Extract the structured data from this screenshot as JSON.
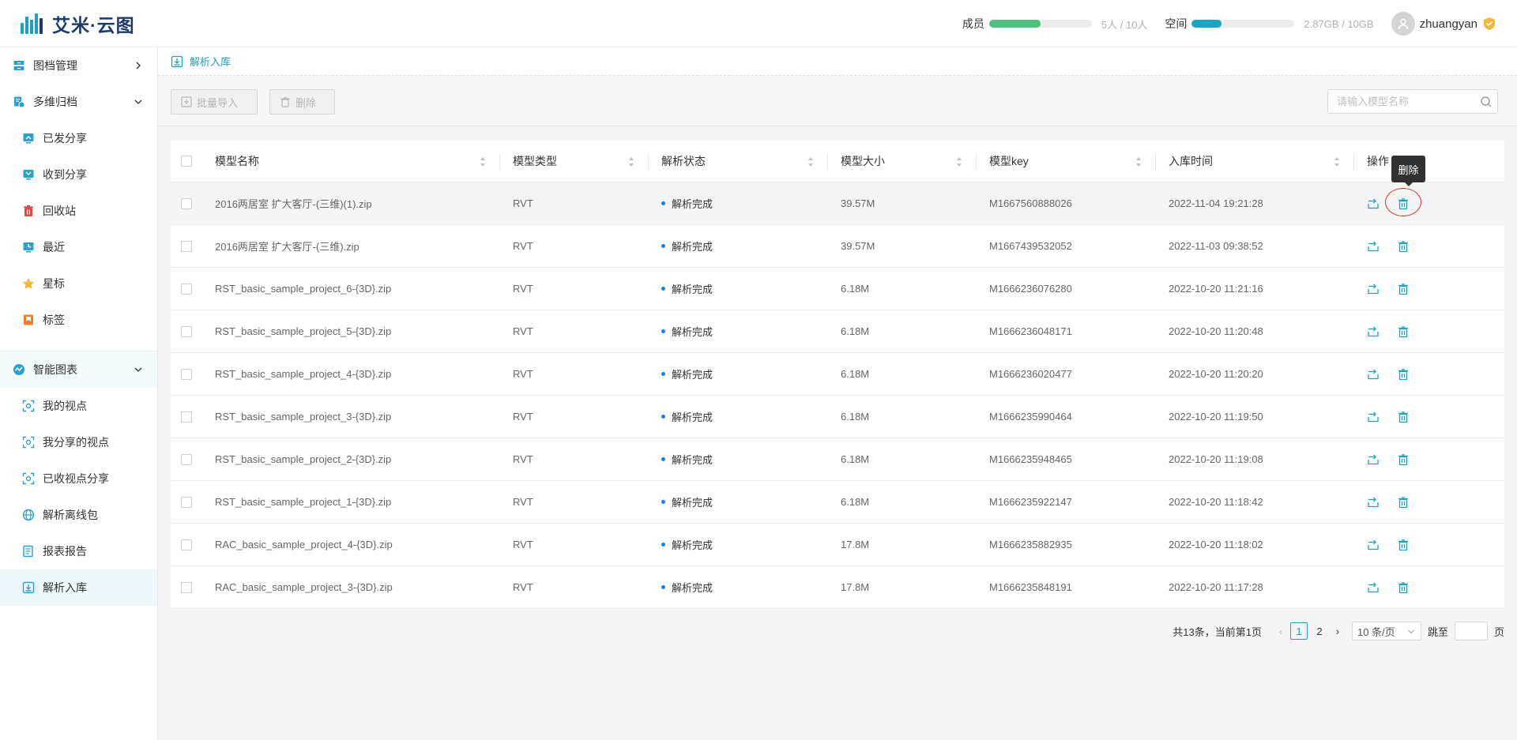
{
  "brand": {
    "name": "艾米·云图"
  },
  "header": {
    "members": {
      "label": "成员",
      "value": "5人 / 10人",
      "fraction": 0.5,
      "color": "#4cc080"
    },
    "space": {
      "label": "空间",
      "value": "2.87GB / 10GB",
      "fraction": 0.287,
      "color": "#1aa3c2"
    },
    "user": {
      "name": "zhuangyan",
      "avatar_icon": "user-avatar-icon",
      "badge_icon": "vip-shield-icon"
    }
  },
  "sidebar": {
    "groups": [
      {
        "label": "图档管理",
        "icon": "archive-icon",
        "expanded": false
      },
      {
        "label": "多维归档",
        "icon": "multi-archive-icon",
        "expanded": true,
        "items": [
          {
            "label": "已发分享",
            "icon": "share-sent-icon"
          },
          {
            "label": "收到分享",
            "icon": "share-received-icon"
          },
          {
            "label": "回收站",
            "icon": "trash-icon"
          },
          {
            "label": "最近",
            "icon": "recent-icon"
          },
          {
            "label": "星标",
            "icon": "star-icon"
          },
          {
            "label": "标签",
            "icon": "tag-icon"
          }
        ]
      },
      {
        "label": "智能图表",
        "icon": "smart-chart-icon",
        "expanded": true,
        "items": [
          {
            "label": "我的视点",
            "icon": "viewpoint-icon"
          },
          {
            "label": "我分享的视点",
            "icon": "viewpoint-shared-icon"
          },
          {
            "label": "已收视点分享",
            "icon": "viewpoint-received-icon"
          },
          {
            "label": "解析离线包",
            "icon": "offline-package-icon"
          },
          {
            "label": "报表报告",
            "icon": "report-icon"
          },
          {
            "label": "解析入库",
            "icon": "import-icon",
            "active": true
          }
        ]
      }
    ]
  },
  "breadcrumb": {
    "label": "解析入库"
  },
  "toolbar": {
    "batch_import": "批量导入",
    "delete": "删除",
    "search_placeholder": "请输入模型名称"
  },
  "table": {
    "columns": [
      "模型名称",
      "模型类型",
      "解析状态",
      "模型大小",
      "模型key",
      "入库时间",
      "操作"
    ],
    "rows": [
      {
        "name": "2016两居室 扩大客厅-(三维)(1).zip",
        "type": "RVT",
        "status": "解析完成",
        "size": "39.57M",
        "key": "M1667560888026",
        "time": "2022-11-04 19:21:28"
      },
      {
        "name": "2016两居室 扩大客厅-(三维).zip",
        "type": "RVT",
        "status": "解析完成",
        "size": "39.57M",
        "key": "M1667439532052",
        "time": "2022-11-03 09:38:52"
      },
      {
        "name": "RST_basic_sample_project_6-{3D}.zip",
        "type": "RVT",
        "status": "解析完成",
        "size": "6.18M",
        "key": "M1666236076280",
        "time": "2022-10-20 11:21:16"
      },
      {
        "name": "RST_basic_sample_project_5-{3D}.zip",
        "type": "RVT",
        "status": "解析完成",
        "size": "6.18M",
        "key": "M1666236048171",
        "time": "2022-10-20 11:20:48"
      },
      {
        "name": "RST_basic_sample_project_4-{3D}.zip",
        "type": "RVT",
        "status": "解析完成",
        "size": "6.18M",
        "key": "M1666236020477",
        "time": "2022-10-20 11:20:20"
      },
      {
        "name": "RST_basic_sample_project_3-{3D}.zip",
        "type": "RVT",
        "status": "解析完成",
        "size": "6.18M",
        "key": "M1666235990464",
        "time": "2022-10-20 11:19:50"
      },
      {
        "name": "RST_basic_sample_project_2-{3D}.zip",
        "type": "RVT",
        "status": "解析完成",
        "size": "6.18M",
        "key": "M1666235948465",
        "time": "2022-10-20 11:19:08"
      },
      {
        "name": "RST_basic_sample_project_1-{3D}.zip",
        "type": "RVT",
        "status": "解析完成",
        "size": "6.18M",
        "key": "M1666235922147",
        "time": "2022-10-20 11:18:42"
      },
      {
        "name": "RAC_basic_sample_project_4-{3D}.zip",
        "type": "RVT",
        "status": "解析完成",
        "size": "17.8M",
        "key": "M1666235882935",
        "time": "2022-10-20 11:18:02"
      },
      {
        "name": "RAC_basic_sample_project_3-{3D}.zip",
        "type": "RVT",
        "status": "解析完成",
        "size": "17.8M",
        "key": "M1666235848191",
        "time": "2022-10-20 11:17:28"
      }
    ],
    "tooltip": "删除"
  },
  "pagination": {
    "summary": "共13条，当前第1页",
    "pages": [
      "1",
      "2"
    ],
    "current": "1",
    "page_size": "10 条/页",
    "jump_label": "跳至",
    "page_suffix": "页"
  },
  "colors": {
    "accent": "#1aa3c2",
    "danger_ring": "#e53535",
    "status_dot": "#1a7fe6"
  }
}
